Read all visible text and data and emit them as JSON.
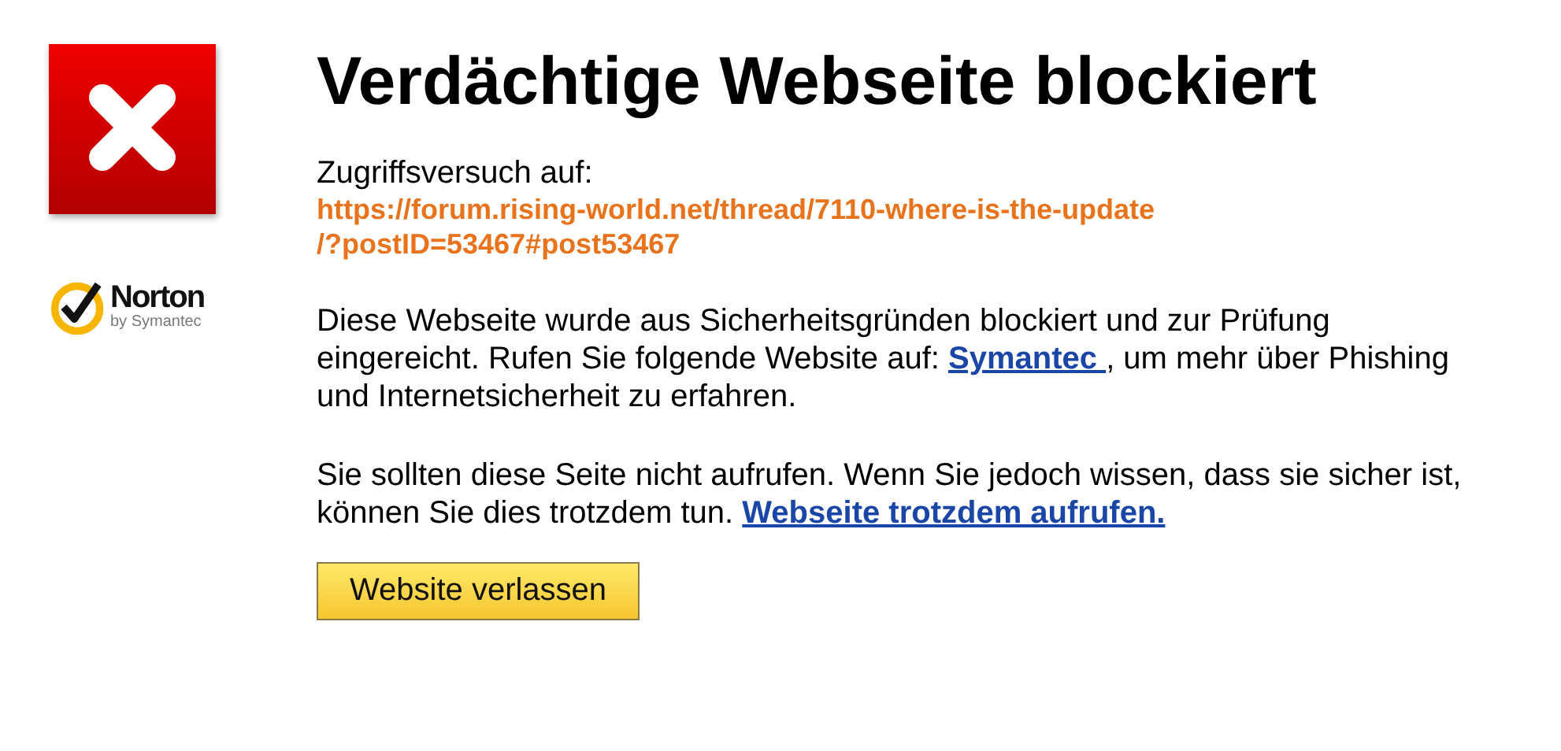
{
  "brand": {
    "name": "Norton",
    "tagline": "by Symantec"
  },
  "title": "Verdächtige Webseite blockiert",
  "access": {
    "label": "Zugriffsversuch auf:",
    "url_lines": [
      "https://forum.rising-world.net/thread/7110-where-is-the-update",
      "/?postID=53467#post53467"
    ]
  },
  "paragraphs": [
    {
      "before": "Diese Webseite wurde aus Sicherheitsgründen blockiert und zur Prüfung eingereicht. Rufen Sie folgende Website auf:",
      "link": "Symantec ",
      "after": ", um mehr über Phishing und Internetsicherheit zu erfahren."
    },
    {
      "before": "Sie sollten diese Seite nicht aufrufen. Wenn Sie jedoch wissen, dass sie sicher ist, können Sie dies trotzdem tun.",
      "link": "Webseite trotzdem aufrufen."
    }
  ],
  "button": "Website verlassen"
}
